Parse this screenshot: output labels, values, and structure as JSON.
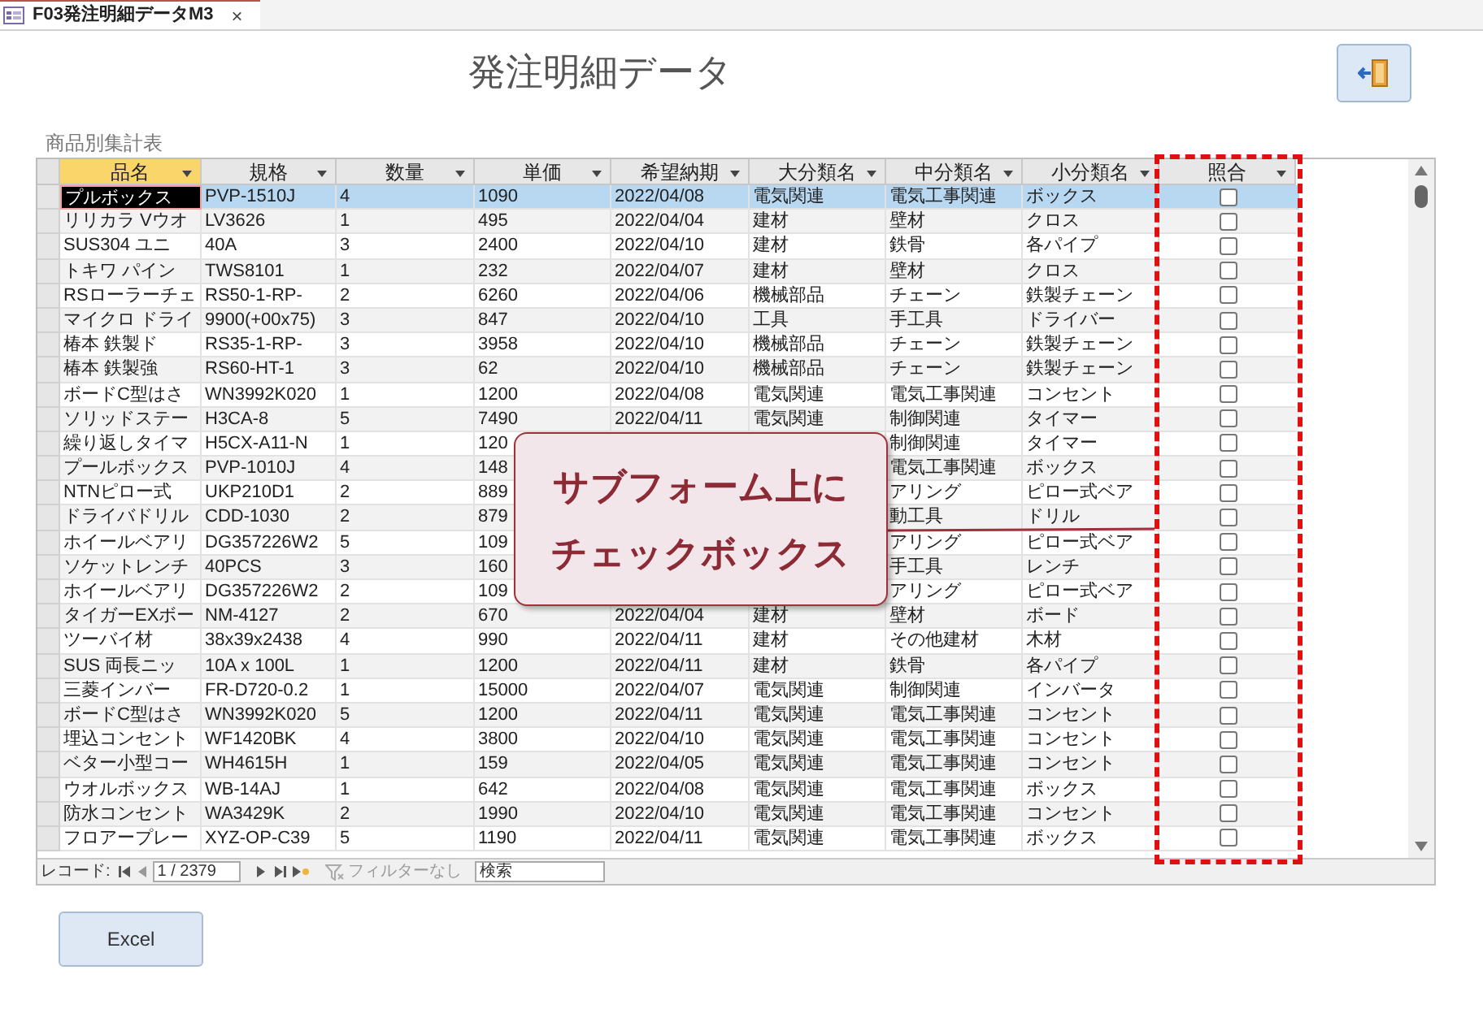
{
  "tab": {
    "title": "F03発注明細データM3",
    "close": "×"
  },
  "heading": "発注明細データ",
  "subform_label": "商品別集計表",
  "columns": [
    {
      "label": "品名",
      "selected": true
    },
    {
      "label": "規格",
      "selected": false
    },
    {
      "label": "数量",
      "selected": false
    },
    {
      "label": "単価",
      "selected": false
    },
    {
      "label": "希望納期",
      "selected": false
    },
    {
      "label": "大分類名",
      "selected": false
    },
    {
      "label": "中分類名",
      "selected": false
    },
    {
      "label": "小分類名",
      "selected": false
    },
    {
      "label": "照合",
      "selected": false
    }
  ],
  "rows": [
    {
      "name": "プルボックス",
      "spec": "PVP-1510J",
      "qty": "4",
      "price": "1090",
      "due": "2022/04/08",
      "major": "電気関連",
      "middle": "電気工事関連",
      "minor": "ボックス",
      "checked": false,
      "selected": true
    },
    {
      "name": "リリカラ Vウオ",
      "spec": "LV3626",
      "qty": "1",
      "price": "495",
      "due": "2022/04/04",
      "major": "建材",
      "middle": "壁材",
      "minor": "クロス",
      "checked": false,
      "selected": false
    },
    {
      "name": "SUS304 ユニ",
      "spec": "40A",
      "qty": "3",
      "price": "2400",
      "due": "2022/04/10",
      "major": "建材",
      "middle": "鉄骨",
      "minor": "各パイプ",
      "checked": false,
      "selected": false
    },
    {
      "name": "トキワ パイン",
      "spec": "TWS8101",
      "qty": "1",
      "price": "232",
      "due": "2022/04/07",
      "major": "建材",
      "middle": "壁材",
      "minor": "クロス",
      "checked": false,
      "selected": false
    },
    {
      "name": "RSローラーチェ",
      "spec": "RS50-1-RP-",
      "qty": "2",
      "price": "6260",
      "due": "2022/04/06",
      "major": "機械部品",
      "middle": "チェーン",
      "minor": "鉄製チェーン",
      "checked": false,
      "selected": false
    },
    {
      "name": "マイクロ ドライ",
      "spec": "9900(+00x75)",
      "qty": "3",
      "price": "847",
      "due": "2022/04/10",
      "major": "工具",
      "middle": "手工具",
      "minor": "ドライバー",
      "checked": false,
      "selected": false
    },
    {
      "name": "椿本 鉄製ド",
      "spec": "RS35-1-RP-",
      "qty": "3",
      "price": "3958",
      "due": "2022/04/10",
      "major": "機械部品",
      "middle": "チェーン",
      "minor": "鉄製チェーン",
      "checked": false,
      "selected": false
    },
    {
      "name": "椿本 鉄製強",
      "spec": "RS60-HT-1",
      "qty": "3",
      "price": "62",
      "due": "2022/04/10",
      "major": "機械部品",
      "middle": "チェーン",
      "minor": "鉄製チェーン",
      "checked": false,
      "selected": false
    },
    {
      "name": "ボードC型はさ",
      "spec": "WN3992K020",
      "qty": "1",
      "price": "1200",
      "due": "2022/04/08",
      "major": "電気関連",
      "middle": "電気工事関連",
      "minor": "コンセント",
      "checked": false,
      "selected": false
    },
    {
      "name": "ソリッドステー",
      "spec": "H3CA-8",
      "qty": "5",
      "price": "7490",
      "due": "2022/04/11",
      "major": "電気関連",
      "middle": "制御関連",
      "minor": "タイマー",
      "checked": false,
      "selected": false
    },
    {
      "name": "繰り返しタイマ",
      "spec": "H5CX-A11-N",
      "qty": "1",
      "price": "120",
      "middle": "制御関連",
      "minor": "タイマー",
      "checked": false,
      "selected": false
    },
    {
      "name": "プールボックス",
      "spec": "PVP-1010J",
      "qty": "4",
      "price": "148",
      "middle": "電気工事関連",
      "minor": "ボックス",
      "checked": false,
      "selected": false
    },
    {
      "name": "NTNピロー式",
      "spec": "UKP210D1",
      "qty": "2",
      "price": "889",
      "middle": "アリング",
      "minor": "ピロー式ベア",
      "checked": false,
      "selected": false
    },
    {
      "name": "ドライバドリル",
      "spec": "CDD-1030",
      "qty": "2",
      "price": "879",
      "middle": "動工具",
      "minor": "ドリル",
      "checked": false,
      "selected": false
    },
    {
      "name": "ホイールベアリ",
      "spec": "DG357226W2",
      "qty": "5",
      "price": "109",
      "middle": "アリング",
      "minor": "ピロー式ベア",
      "checked": false,
      "selected": false
    },
    {
      "name": "ソケットレンチ",
      "spec": "40PCS",
      "qty": "3",
      "price": "160",
      "middle": "手工具",
      "minor": "レンチ",
      "checked": false,
      "selected": false
    },
    {
      "name": "ホイールベアリ",
      "spec": "DG357226W2",
      "qty": "2",
      "price": "109",
      "middle": "アリング",
      "minor": "ピロー式ベア",
      "checked": false,
      "selected": false
    },
    {
      "name": "タイガーEXボー",
      "spec": "NM-4127",
      "qty": "2",
      "price": "670",
      "due": "2022/04/04",
      "major": "建材",
      "middle": "壁材",
      "minor": "ボード",
      "checked": false,
      "selected": false
    },
    {
      "name": "ツーバイ材",
      "spec": "38x39x2438",
      "qty": "4",
      "price": "990",
      "due": "2022/04/11",
      "major": "建材",
      "middle": "その他建材",
      "minor": "木材",
      "checked": false,
      "selected": false
    },
    {
      "name": "SUS 両長ニッ",
      "spec": "10A x 100L",
      "qty": "1",
      "price": "1200",
      "due": "2022/04/11",
      "major": "建材",
      "middle": "鉄骨",
      "minor": "各パイプ",
      "checked": false,
      "selected": false
    },
    {
      "name": "三菱インバー",
      "spec": "FR-D720-0.2",
      "qty": "1",
      "price": "15000",
      "due": "2022/04/07",
      "major": "電気関連",
      "middle": "制御関連",
      "minor": "インバータ",
      "checked": false,
      "selected": false
    },
    {
      "name": "ボードC型はさ",
      "spec": "WN3992K020",
      "qty": "5",
      "price": "1200",
      "due": "2022/04/11",
      "major": "電気関連",
      "middle": "電気工事関連",
      "minor": "コンセント",
      "checked": false,
      "selected": false
    },
    {
      "name": "埋込コンセント",
      "spec": "WF1420BK",
      "qty": "4",
      "price": "3800",
      "due": "2022/04/10",
      "major": "電気関連",
      "middle": "電気工事関連",
      "minor": "コンセント",
      "checked": false,
      "selected": false
    },
    {
      "name": "ベター小型コー",
      "spec": "WH4615H",
      "qty": "1",
      "price": "159",
      "due": "2022/04/05",
      "major": "電気関連",
      "middle": "電気工事関連",
      "minor": "コンセント",
      "checked": false,
      "selected": false
    },
    {
      "name": "ウオルボックス",
      "spec": "WB-14AJ",
      "qty": "1",
      "price": "642",
      "due": "2022/04/08",
      "major": "電気関連",
      "middle": "電気工事関連",
      "minor": "ボックス",
      "checked": false,
      "selected": false
    },
    {
      "name": "防水コンセント",
      "spec": "WA3429K",
      "qty": "2",
      "price": "1990",
      "due": "2022/04/10",
      "major": "電気関連",
      "middle": "電気工事関連",
      "minor": "コンセント",
      "checked": false,
      "selected": false
    },
    {
      "name": "フロアープレー",
      "spec": "XYZ-OP-C39",
      "qty": "5",
      "price": "1190",
      "due": "2022/04/11",
      "major": "電気関連",
      "middle": "電気工事関連",
      "minor": "ボックス",
      "checked": false,
      "selected": false
    }
  ],
  "navigation": {
    "label": "レコード:",
    "record": "1 / 2379",
    "filter": "フィルターなし",
    "search_placeholder": "検索"
  },
  "callout": [
    "サブフォーム上に",
    "チェックボックス"
  ],
  "excel_button": "Excel"
}
